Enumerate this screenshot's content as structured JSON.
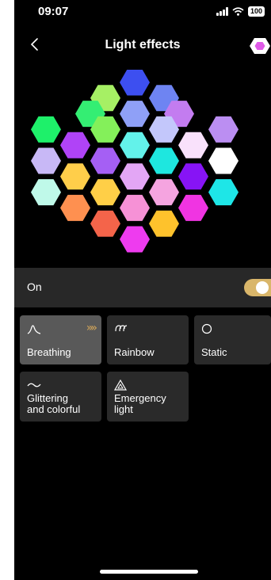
{
  "status_bar": {
    "time": "09:07",
    "battery": "100"
  },
  "header": {
    "title": "Light effects",
    "back_icon": "chevron-left-icon",
    "device_icon": "hexagon-icon"
  },
  "panel": {
    "colors": [
      "#3d4ff0",
      "#a6f064",
      "#6e84f2",
      "#34ee73",
      "#8fa0f7",
      "#c37cf0",
      "#1ef06a",
      "#84f05a",
      "#c3c7fb",
      "#bb8ef2",
      "#b043f7",
      "#63f2ea",
      "#f9e1fb",
      "#c8b8f6",
      "#a55ff4",
      "#1ee7df",
      "#ffffff",
      "#ffce4a",
      "#e3a6f5",
      "#8714f5",
      "#bff9e9",
      "#ffcf47",
      "#f5a4e0",
      "#1ee6e7",
      "#fe9050",
      "#f691d6",
      "#f034e2",
      "#f4644a",
      "#fec22c",
      "#ee3bef",
      "#f7462a",
      "#ff5dee",
      "#ff2c2c"
    ]
  },
  "power": {
    "label": "On",
    "state": "on"
  },
  "effects": [
    {
      "label": "Breathing",
      "icon": "wave-peak-icon",
      "active": true,
      "indicator": "»»"
    },
    {
      "label": "Rainbow",
      "icon": "rainbow-swirl-icon",
      "active": false
    },
    {
      "label": "Static",
      "icon": "circle-icon",
      "active": false
    },
    {
      "label": "Glittering\nand colorful",
      "icon": "tilde-wave-icon",
      "active": false
    },
    {
      "label": "Emergency\nlight",
      "icon": "warning-triangle-icon",
      "active": false
    }
  ],
  "accent": "#d9b66a"
}
